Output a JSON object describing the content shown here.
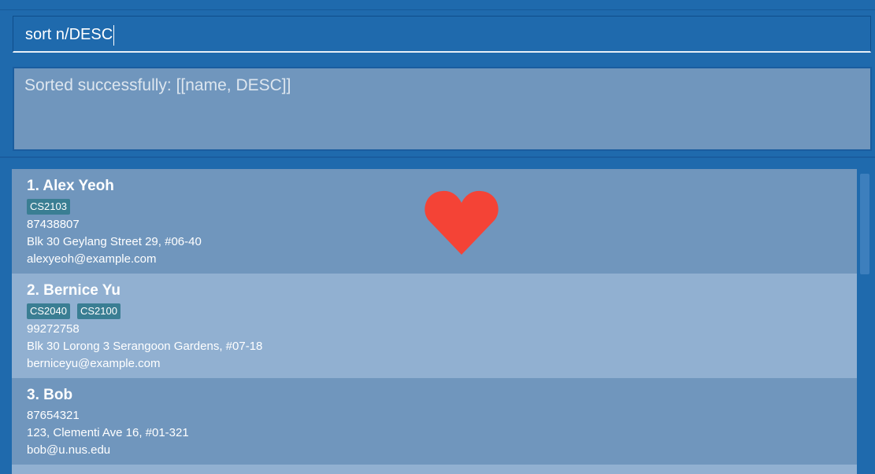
{
  "command": {
    "value": "sort n/DESC"
  },
  "result": {
    "message": "Sorted successfully: [[name, DESC]]"
  },
  "persons": [
    {
      "index_name": "1.  Alex Yeoh",
      "tags": [
        "CS2103"
      ],
      "phone": "87438807",
      "address": "Blk 30 Geylang Street 29, #06-40",
      "email": "alexyeoh@example.com"
    },
    {
      "index_name": "2.  Bernice Yu",
      "tags": [
        "CS2040",
        "CS2100"
      ],
      "phone": "99272758",
      "address": "Blk 30 Lorong 3 Serangoon Gardens, #07-18",
      "email": "berniceyu@example.com"
    },
    {
      "index_name": "3.  Bob",
      "tags": [],
      "phone": "87654321",
      "address": "123, Clementi Ave 16, #01-321",
      "email": "bob@u.nus.edu"
    }
  ],
  "icons": {
    "favorite": "heart-icon"
  },
  "colors": {
    "background": "#1f6aad",
    "card_odd": "#7096bd",
    "card_even": "#91b0d1",
    "tag": "#3a7e93",
    "heart": "#f44336"
  }
}
